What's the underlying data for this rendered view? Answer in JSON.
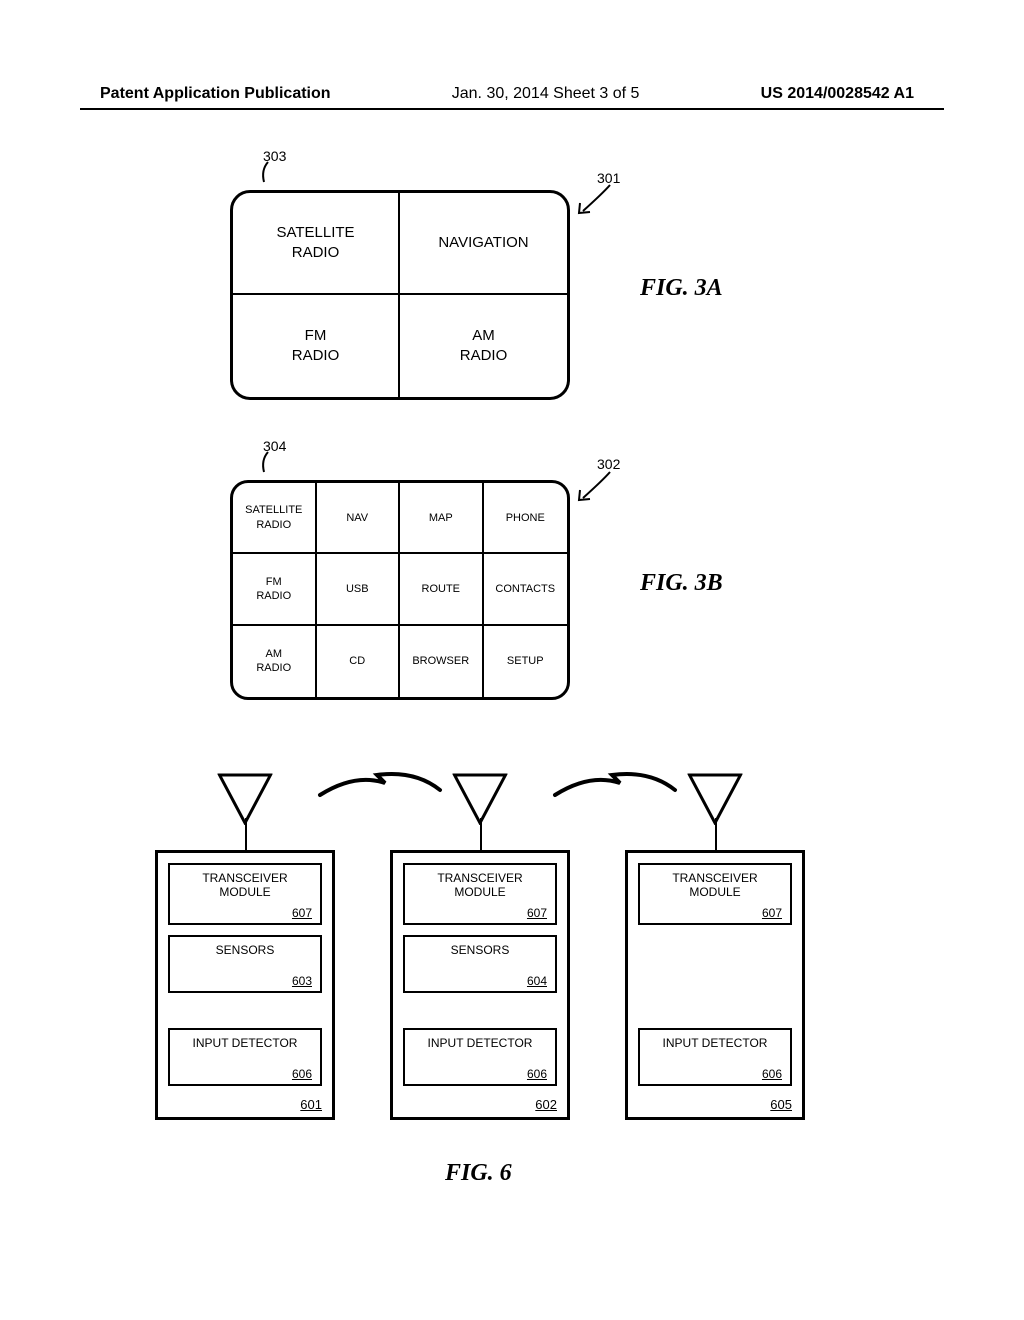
{
  "header": {
    "left": "Patent Application Publication",
    "center": "Jan. 30, 2014  Sheet 3 of 5",
    "right": "US 2014/0028542 A1"
  },
  "fig3a": {
    "ref_303": "303",
    "ref_301": "301",
    "label": "FIG.  3A",
    "cells": [
      "SATELLITE\nRADIO",
      "NAVIGATION",
      "FM\nRADIO",
      "AM\nRADIO"
    ]
  },
  "fig3b": {
    "ref_304": "304",
    "ref_302": "302",
    "label": "FIG.  3B",
    "cells": [
      "SATELLITE\nRADIO",
      "NAV",
      "MAP",
      "PHONE",
      "FM\nRADIO",
      "USB",
      "ROUTE",
      "CONTACTS",
      "AM\nRADIO",
      "CD",
      "BROWSER",
      "SETUP"
    ]
  },
  "fig6": {
    "label": "FIG.  6",
    "transceiver": "TRANSCEIVER\nMODULE",
    "transceiver_num": "607",
    "sensors": "SENSORS",
    "sensors_num_1": "603",
    "sensors_num_2": "604",
    "input_detector": "INPUT DETECTOR",
    "input_detector_num": "606",
    "device_nums": [
      "601",
      "602",
      "605"
    ]
  }
}
